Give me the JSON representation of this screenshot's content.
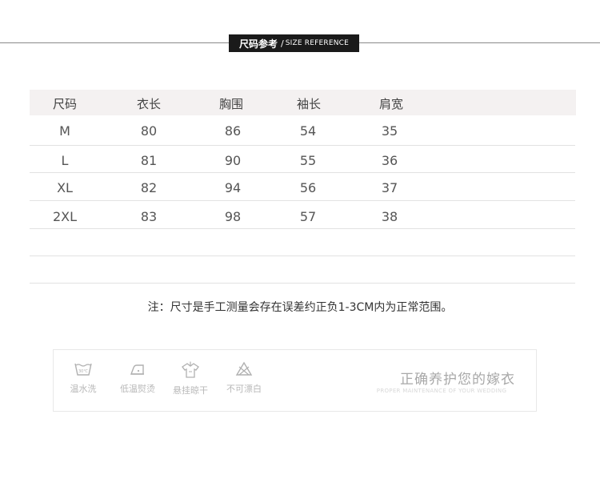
{
  "header": {
    "title_cn": "尺码参考",
    "separator": "/",
    "title_en": "SIZE REFERENCE"
  },
  "table": {
    "columns": [
      "尺码",
      "衣长",
      "胸围",
      "袖长",
      "肩宽"
    ],
    "rows": [
      [
        "M",
        "80",
        "86",
        "54",
        "35"
      ],
      [
        "L",
        "81",
        "90",
        "55",
        "36"
      ],
      [
        "XL",
        "82",
        "94",
        "56",
        "37"
      ],
      [
        "2XL",
        "83",
        "98",
        "57",
        "38"
      ]
    ]
  },
  "note": "注：尺寸是手工测量会存在误差约正负1-3CM内为正常范围。",
  "care": {
    "items": [
      {
        "icon": "wash-30-icon",
        "label": "温水洗",
        "badge": "30℃"
      },
      {
        "icon": "iron-low-icon",
        "label": "低温熨烫"
      },
      {
        "icon": "hang-dry-icon",
        "label": "悬挂晾干"
      },
      {
        "icon": "no-bleach-icon",
        "label": "不可漂白"
      }
    ],
    "title": "正确养护您的嫁衣",
    "subtitle": "PROPER MAINTENANCE OF YOUR WEDDING"
  }
}
